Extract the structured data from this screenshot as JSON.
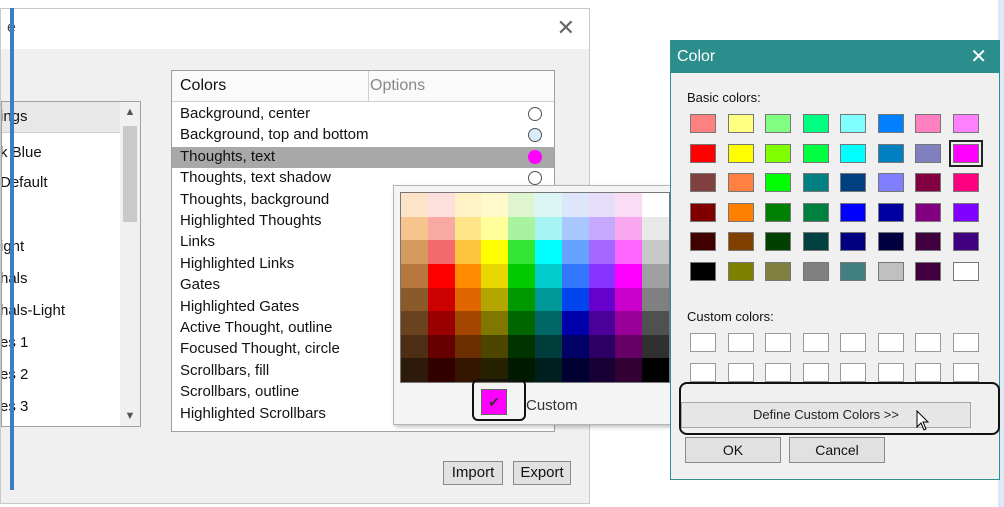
{
  "main_window": {
    "title_fragment": "e",
    "close_glyph": "✕"
  },
  "schemes": {
    "header": "ings",
    "items": [
      "k Blue",
      "Default",
      "",
      "ight",
      "hals",
      "hals-Light",
      "es 1",
      "es 2",
      "es 3"
    ]
  },
  "colors_panel": {
    "header_colors": "Colors",
    "header_options": "Options",
    "rows": [
      {
        "label": "Background, center",
        "swatch": "#ffffff",
        "selected": false
      },
      {
        "label": "Background, top and bottom",
        "swatch": "#d9ecfb",
        "selected": false
      },
      {
        "label": "Thoughts, text",
        "swatch": "#ff00ff",
        "selected": true
      },
      {
        "label": "Thoughts, text shadow",
        "swatch": "#ffffff",
        "selected": false
      },
      {
        "label": "Thoughts, background",
        "swatch": "",
        "selected": false
      },
      {
        "label": "Highlighted Thoughts",
        "swatch": "",
        "selected": false
      },
      {
        "label": "Links",
        "swatch": "",
        "selected": false
      },
      {
        "label": "Highlighted Links",
        "swatch": "",
        "selected": false
      },
      {
        "label": "Gates",
        "swatch": "",
        "selected": false
      },
      {
        "label": "Highlighted Gates",
        "swatch": "",
        "selected": false
      },
      {
        "label": "Active Thought, outline",
        "swatch": "",
        "selected": false
      },
      {
        "label": "Focused Thought, circle",
        "swatch": "",
        "selected": false
      },
      {
        "label": "Scrollbars, fill",
        "swatch": "",
        "selected": false
      },
      {
        "label": "Scrollbars, outline",
        "swatch": "",
        "selected": false
      },
      {
        "label": "Highlighted Scrollbars",
        "swatch": "",
        "selected": false
      }
    ]
  },
  "buttons": {
    "import": "Import",
    "export": "Export"
  },
  "palette_popup": {
    "rows": [
      [
        "#fde3c7",
        "#fde0dc",
        "#fff2c4",
        "#fff9cc",
        "#dff5d0",
        "#dcf6f6",
        "#dde6fb",
        "#e6ddfb",
        "#fbdcf5",
        "#ffffff"
      ],
      [
        "#f7c48e",
        "#f9a9a4",
        "#ffe58a",
        "#ffff99",
        "#a8f2a0",
        "#a6f4f4",
        "#a8c8ff",
        "#c6a8ff",
        "#f9a8f0",
        "#e8e8e8"
      ],
      [
        "#d49a5e",
        "#f26a6a",
        "#ffc43d",
        "#ffff00",
        "#33e633",
        "#00ffff",
        "#66a3ff",
        "#a366ff",
        "#ff66ff",
        "#c8c8c8"
      ],
      [
        "#b7773f",
        "#ff0000",
        "#ff8c00",
        "#e6d800",
        "#00cc00",
        "#00cccc",
        "#3377ff",
        "#8833ff",
        "#ff00ff",
        "#a0a0a0"
      ],
      [
        "#8b5a2b",
        "#cc0000",
        "#e06600",
        "#b3a600",
        "#009900",
        "#009999",
        "#0044ee",
        "#6600cc",
        "#cc00cc",
        "#808080"
      ],
      [
        "#6b4220",
        "#990000",
        "#a34700",
        "#807700",
        "#006600",
        "#006666",
        "#0000aa",
        "#4a0099",
        "#990099",
        "#505050"
      ],
      [
        "#4d2e14",
        "#660000",
        "#6b2e00",
        "#4d4600",
        "#003300",
        "#003d3d",
        "#000066",
        "#2e0066",
        "#660066",
        "#303030"
      ],
      [
        "#2e1a0a",
        "#330000",
        "#331500",
        "#262200",
        "#001a00",
        "#001f1f",
        "#000033",
        "#170033",
        "#330033",
        "#000000"
      ]
    ],
    "current_color": "#ff00ff",
    "check_glyph": "✔",
    "custom_label": "Custom"
  },
  "color_dialog": {
    "title": "Color",
    "close_glyph": "✕",
    "basic_label": "Basic colors:",
    "basic_colors": [
      [
        "#ff8080",
        "#ffff80",
        "#80ff80",
        "#00ff80",
        "#80ffff",
        "#0080ff",
        "#ff80c0",
        "#ff80ff"
      ],
      [
        "#ff0000",
        "#ffff00",
        "#80ff00",
        "#00ff40",
        "#00ffff",
        "#0080c0",
        "#8080c0",
        "#ff00ff"
      ],
      [
        "#804040",
        "#ff8040",
        "#00ff00",
        "#008080",
        "#004080",
        "#8080ff",
        "#800040",
        "#ff0080"
      ],
      [
        "#800000",
        "#ff8000",
        "#008000",
        "#008040",
        "#0000ff",
        "#0000a0",
        "#800080",
        "#8000ff"
      ],
      [
        "#400000",
        "#804000",
        "#004000",
        "#004040",
        "#000080",
        "#000040",
        "#400040",
        "#400080"
      ],
      [
        "#000000",
        "#808000",
        "#808040",
        "#808080",
        "#408080",
        "#c0c0c0",
        "#400040",
        "#ffffff"
      ]
    ],
    "selected_basic": "#ff00ff",
    "custom_label": "Custom colors:",
    "define_button": "Define Custom Colors >>",
    "ok": "OK",
    "cancel": "Cancel"
  }
}
